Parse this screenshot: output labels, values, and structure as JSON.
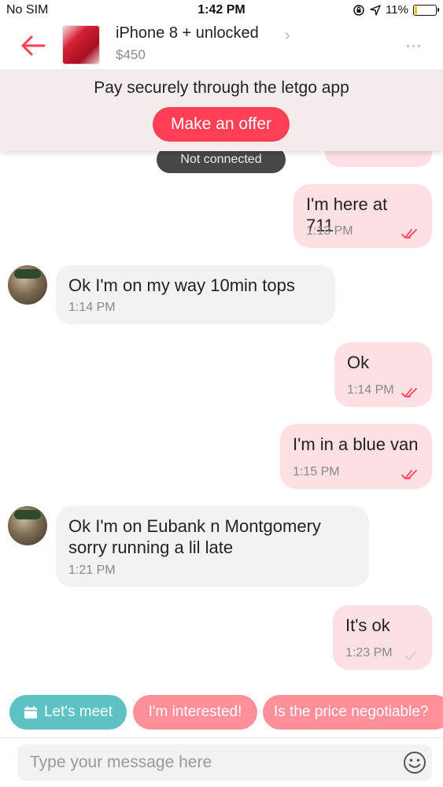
{
  "status_bar": {
    "carrier": "No SIM",
    "time": "1:42 PM",
    "battery": "11%",
    "battery_level": 0.11
  },
  "header": {
    "title": "iPhone 8 + unlocked",
    "price": "$450"
  },
  "banner": {
    "text": "Pay securely through the letgo app",
    "offer_button": "Make an offer"
  },
  "chat": {
    "connection_status": "Not connected",
    "messages": [
      {
        "direction": "out",
        "text": "I'm here at 711",
        "time": "1:13 PM",
        "read": true
      },
      {
        "direction": "in",
        "text": "Ok I'm on my way 10min tops",
        "time": "1:14 PM"
      },
      {
        "direction": "out",
        "text": "Ok",
        "time": "1:14 PM",
        "read": true
      },
      {
        "direction": "out",
        "text": "I'm in a blue van",
        "time": "1:15 PM",
        "read": true
      },
      {
        "direction": "in",
        "text": "Ok I'm on Eubank n Montgomery\nsorry running a lil late",
        "time": "1:21 PM"
      },
      {
        "direction": "out",
        "text": "It's ok",
        "time": "1:23 PM",
        "read": false
      }
    ]
  },
  "quick_replies": [
    {
      "label": "Let's meet",
      "icon": "calendar-icon"
    },
    {
      "label": "I'm interested!"
    },
    {
      "label": "Is the price negotiable?"
    }
  ],
  "composer": {
    "placeholder": "Type your message here",
    "emoji_icon": "smiley-icon"
  },
  "colors": {
    "accent": "#ff3f55",
    "outgoing_bubble": "#fde0e4",
    "incoming_bubble": "#f2f2f2",
    "meet_chip": "#5ec2c5",
    "chip": "#ff8f99",
    "read_check": "#ff3f55",
    "unread_check": "#cfcfcf"
  }
}
